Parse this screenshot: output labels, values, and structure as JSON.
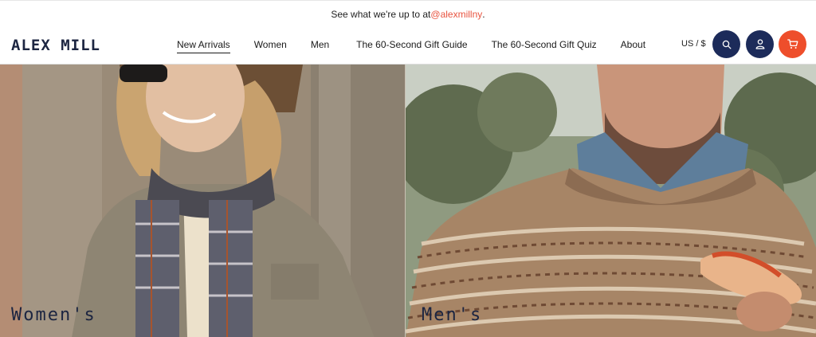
{
  "announcement": {
    "prefix": "See what we're up to at ",
    "handle": "@alexmillny",
    "suffix": "."
  },
  "header": {
    "logo": "ALEX MILL",
    "nav": [
      {
        "label": "New Arrivals",
        "active": true
      },
      {
        "label": "Women",
        "active": false
      },
      {
        "label": "Men",
        "active": false
      },
      {
        "label": "The 60-Second Gift Guide",
        "active": false
      },
      {
        "label": "The 60-Second Gift Quiz",
        "active": false
      },
      {
        "label": "About",
        "active": false
      }
    ],
    "currency": "US / $",
    "icons": {
      "search": "search-icon",
      "account": "user-icon",
      "cart": "cart-icon"
    }
  },
  "hero": {
    "women_label": "Women's",
    "men_label": "Men's"
  },
  "colors": {
    "navy": "#1c2b5a",
    "accent": "#ee4e2b",
    "link": "#e8533f"
  }
}
